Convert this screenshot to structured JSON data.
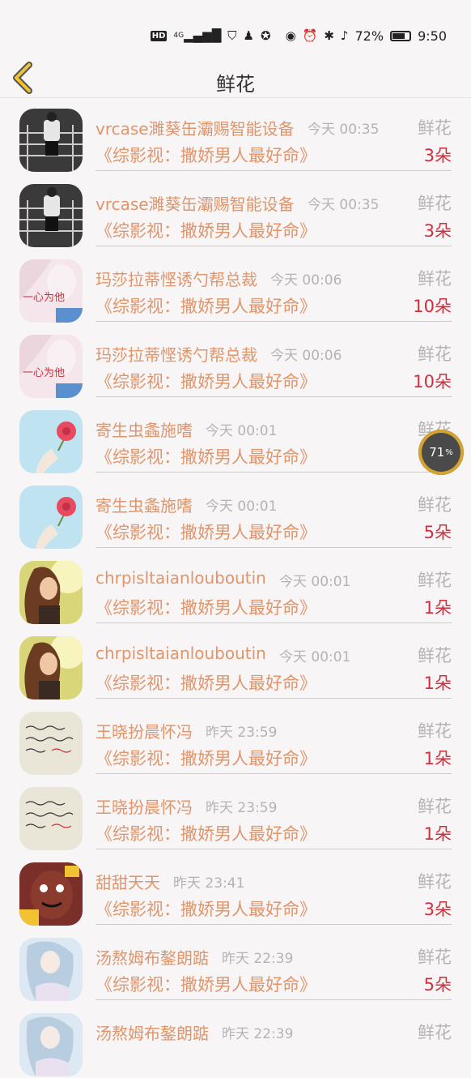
{
  "status": {
    "hd": "HD",
    "net": "4G",
    "battery": "72%",
    "time": "9:50"
  },
  "header": {
    "title": "鲜花"
  },
  "items": [
    {
      "name": "vrcase濉葵缶灞赐智能设备",
      "time": "今天 00:35",
      "gift": "鲜花",
      "book": "《综影视：撒娇男人最好命》",
      "count": "3朵",
      "avatar": "bw"
    },
    {
      "name": "vrcase濉葵缶灞赐智能设备",
      "time": "今天 00:35",
      "gift": "鲜花",
      "book": "《综影视：撒娇男人最好命》",
      "count": "3朵",
      "avatar": "bw"
    },
    {
      "name": "玛莎拉蒂悭诱勺帮总裁",
      "time": "今天 00:06",
      "gift": "鲜花",
      "book": "《综影视：撒娇男人最好命》",
      "count": "10朵",
      "avatar": "pink"
    },
    {
      "name": "玛莎拉蒂悭诱勺帮总裁",
      "time": "今天 00:06",
      "gift": "鲜花",
      "book": "《综影视：撒娇男人最好命》",
      "count": "10朵",
      "avatar": "pink"
    },
    {
      "name": "寄生虫螽施嗜",
      "time": "今天 00:01",
      "gift": "鲜花",
      "book": "《综影视：撒娇男人最好命》",
      "count": "",
      "avatar": "flower"
    },
    {
      "name": "寄生虫螽施嗜",
      "time": "今天 00:01",
      "gift": "鲜花",
      "book": "《综影视：撒娇男人最好命》",
      "count": "5朵",
      "avatar": "flower"
    },
    {
      "name": "chrpisltaianlouboutin",
      "time": "今天 00:01",
      "gift": "鲜花",
      "book": "《综影视：撒娇男人最好命》",
      "count": "1朵",
      "avatar": "girl"
    },
    {
      "name": "chrpisltaianlouboutin",
      "time": "今天 00:01",
      "gift": "鲜花",
      "book": "《综影视：撒娇男人最好命》",
      "count": "1朵",
      "avatar": "girl"
    },
    {
      "name": "王晓扮晨怀冯",
      "time": "昨天 23:59",
      "gift": "鲜花",
      "book": "《综影视：撒娇男人最好命》",
      "count": "1朵",
      "avatar": "note"
    },
    {
      "name": "王晓扮晨怀冯",
      "time": "昨天 23:59",
      "gift": "鲜花",
      "book": "《综影视：撒娇男人最好命》",
      "count": "1朵",
      "avatar": "note"
    },
    {
      "name": "甜甜天天",
      "time": "昨天 23:41",
      "gift": "鲜花",
      "book": "《综影视：撒娇男人最好命》",
      "count": "3朵",
      "avatar": "cartoon"
    },
    {
      "name": "汤熬姆布鏊朗踮",
      "time": "昨天 22:39",
      "gift": "鲜花",
      "book": "《综影视：撒娇男人最好命》",
      "count": "5朵",
      "avatar": "anime"
    },
    {
      "name": "汤熬姆布鏊朗踮",
      "time": "昨天 22:39",
      "gift": "鲜花",
      "book": "",
      "count": "",
      "avatar": "anime"
    }
  ],
  "avatar_text": {
    "pink": "一心为他"
  },
  "float_widget": {
    "value": "71",
    "unit": "%"
  }
}
